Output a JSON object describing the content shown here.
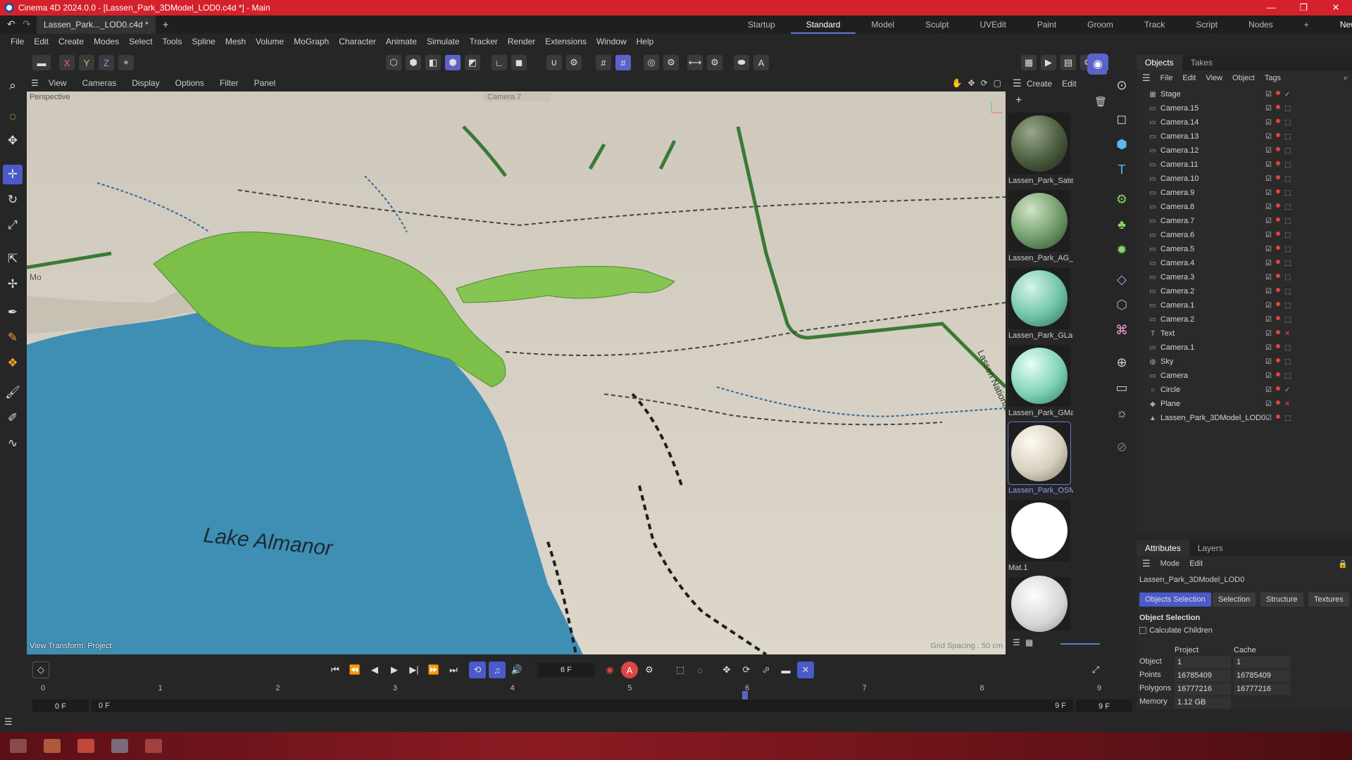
{
  "window": {
    "title": "Cinema 4D 2024.0.0 - [Lassen_Park_3DModel_LOD0.c4d *] - Main"
  },
  "tabs": {
    "document": "Lassen_Park..._LOD0.c4d *",
    "add": "+"
  },
  "layouts": [
    "Startup",
    "Standard",
    "Model",
    "Sculpt",
    "UVEdit",
    "Paint",
    "Groom",
    "Track",
    "Script",
    "Nodes"
  ],
  "layouts_extra": {
    "add": "+",
    "new_layouts": "New Layouts"
  },
  "menu": [
    "File",
    "Edit",
    "Create",
    "Modes",
    "Select",
    "Tools",
    "Spline",
    "Mesh",
    "Volume",
    "MoGraph",
    "Character",
    "Animate",
    "Simulate",
    "Tracker",
    "Render",
    "Extensions",
    "Window",
    "Help"
  ],
  "toolbar": {
    "x": "X",
    "y": "Y",
    "z": "Z"
  },
  "viewport_menu": [
    "View",
    "Cameras",
    "Display",
    "Options",
    "Filter",
    "Panel"
  ],
  "viewport": {
    "name": "Perspective",
    "camera": "Camera.7",
    "view_transform": "View Transform: Project",
    "grid_spacing": "Grid Spacing : 50 cm",
    "lake_label": "Lake Almanor",
    "park_label": "Lassen National Forest",
    "marker_label": "Mo"
  },
  "material_menu": [
    "Create",
    "Edit"
  ],
  "materials": [
    {
      "name": "Lassen_Park_Satel",
      "color": "#4a5b3e"
    },
    {
      "name": "Lassen_Park_AG_L",
      "color": "#6f9a6a"
    },
    {
      "name": "Lassen_Park_GLan",
      "color": "#6fc3a8"
    },
    {
      "name": "Lassen_Park_GMa",
      "color": "#7fd3b6"
    },
    {
      "name": "Lassen_Park_OSM",
      "color": "#d6d0c0"
    },
    {
      "name": "Mat.1",
      "color": "#ffffff"
    },
    {
      "name": "",
      "color": "#e8e8e8"
    }
  ],
  "objects_panel": {
    "tabs": [
      "Objects",
      "Takes"
    ],
    "menu": [
      "File",
      "Edit",
      "View",
      "Object",
      "Tags"
    ],
    "items": [
      "Stage",
      "Camera.15",
      "Camera.14",
      "Camera.13",
      "Camera.12",
      "Camera.11",
      "Camera.10",
      "Camera.9",
      "Camera.8",
      "Camera.7",
      "Camera.6",
      "Camera.5",
      "Camera.4",
      "Camera.3",
      "Camera.2",
      "Camera.1",
      "Camera.2",
      "Text",
      "Camera.1",
      "Sky",
      "Camera",
      "Circle",
      "Plane",
      "Lassen_Park_3DModel_LOD0"
    ]
  },
  "attributes": {
    "tabs": [
      "Attributes",
      "Layers"
    ],
    "menu": [
      "Mode",
      "Edit"
    ],
    "object_name": "Lassen_Park_3DModel_LOD0",
    "buttons": [
      "Objects Selection",
      "Selection",
      "Structure",
      "Textures"
    ],
    "section": "Object Selection",
    "calc_children": "Calculate Children",
    "col_project": "Project",
    "col_cache": "Cache",
    "rows": [
      {
        "label": "Object",
        "project": "1",
        "cache": "1"
      },
      {
        "label": "Points",
        "project": "16785409",
        "cache": "16785409"
      },
      {
        "label": "Polygons",
        "project": "16777216",
        "cache": "16777216"
      },
      {
        "label": "Memory",
        "project": "1.12 GB",
        "cache": ""
      }
    ]
  },
  "timeline": {
    "current_frame": "6 F",
    "start": "0 F",
    "start2": "0 F",
    "end": "9 F",
    "end2": "9 F",
    "ticks": [
      "0",
      "1",
      "2",
      "3",
      "4",
      "5",
      "6",
      "7",
      "8",
      "9"
    ],
    "playhead_frame": 6
  },
  "colors": {
    "title_bg": "#d4212b",
    "accent": "#5b63c8",
    "lake": "#3d8db3",
    "terrain": "#d6d0c4",
    "park": "#7cc04a"
  }
}
